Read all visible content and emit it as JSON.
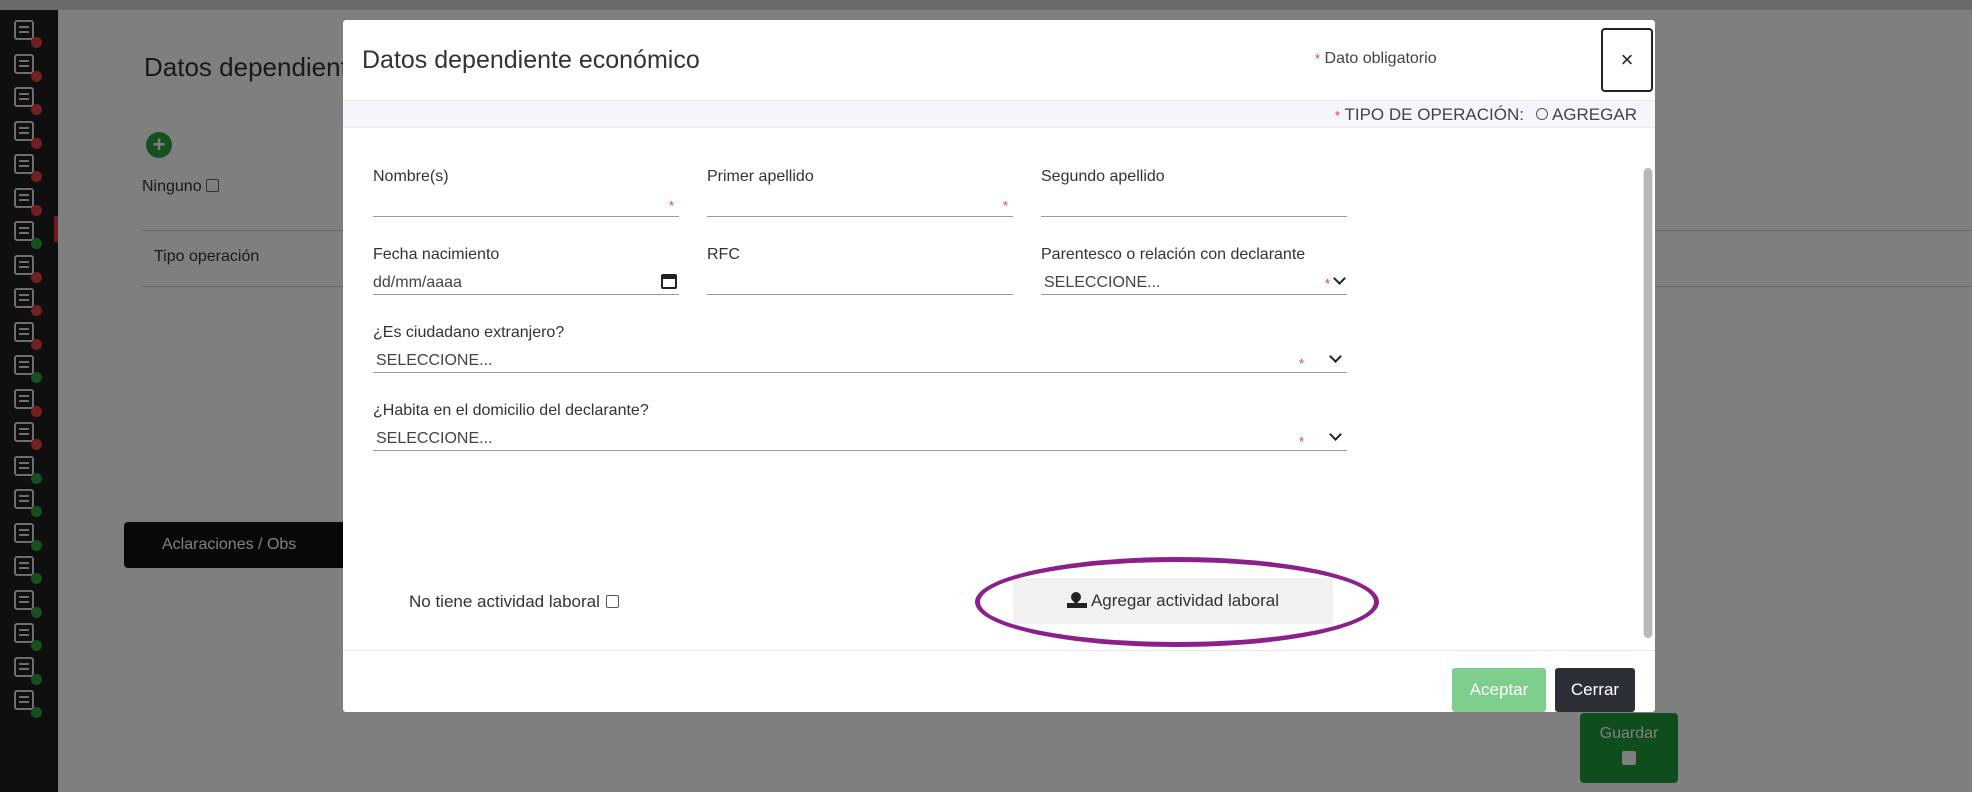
{
  "sidebar": {
    "icons": [
      {
        "name": "id-card-icon",
        "status": "red"
      },
      {
        "name": "home-arrow-icon",
        "status": "red"
      },
      {
        "name": "document-icon",
        "status": "red"
      },
      {
        "name": "building-icon",
        "status": "red"
      },
      {
        "name": "people-link-icon",
        "status": "red"
      },
      {
        "name": "family-icon",
        "status": "red"
      },
      {
        "name": "edit-form-icon",
        "status": "green"
      },
      {
        "name": "search-document-icon",
        "status": "red"
      },
      {
        "name": "house-icon",
        "status": "red"
      },
      {
        "name": "car-icon",
        "status": "red"
      },
      {
        "name": "chart-icon",
        "status": "green"
      },
      {
        "name": "handshake-icon",
        "status": "red"
      },
      {
        "name": "bus-icon",
        "status": "red"
      },
      {
        "name": "house-coin-icon",
        "status": "green"
      },
      {
        "name": "pie-chart-icon",
        "status": "green"
      },
      {
        "name": "person-network-icon",
        "status": "green"
      },
      {
        "name": "group-icon",
        "status": "green"
      },
      {
        "name": "people-row-icon",
        "status": "green"
      },
      {
        "name": "stats-board-icon",
        "status": "green"
      },
      {
        "name": "person-award-icon",
        "status": "green"
      },
      {
        "name": "checklist-icon",
        "status": "green"
      }
    ],
    "status_colors": {
      "red": "#e04040",
      "green": "#2e9e3e"
    }
  },
  "background": {
    "title": "Datos dependiente",
    "ninguno_label": "Ninguno",
    "table_header": "Tipo operación",
    "aclaraciones_label": "Aclaraciones / Obs",
    "guardar_label": "Guardar"
  },
  "modal": {
    "title": "Datos dependiente económico",
    "required_marker": "*",
    "required_note": "Dato obligatorio",
    "close_label": "×",
    "operation_label": "TIPO DE OPERACIÓN:",
    "operation_option": "AGREGAR",
    "fields": {
      "nombre": {
        "label": "Nombre(s)",
        "value": ""
      },
      "primer_apellido": {
        "label": "Primer apellido",
        "value": ""
      },
      "segundo_apellido": {
        "label": "Segundo apellido",
        "value": ""
      },
      "fecha_nacimiento": {
        "label": "Fecha nacimiento",
        "value": "dd/mm/aaaa"
      },
      "rfc": {
        "label": "RFC",
        "value": ""
      },
      "parentesco": {
        "label": "Parentesco o relación con declarante",
        "value": "SELECCIONE..."
      },
      "ciudadano_extranjero": {
        "label": "¿Es ciudadano extranjero?",
        "value": "SELECCIONE..."
      },
      "habita_domicilio": {
        "label": "¿Habita en el domicilio del declarante?",
        "value": "SELECCIONE..."
      }
    },
    "no_work_label": "No tiene actividad laboral",
    "add_work_label": "Agregar actividad laboral",
    "accept_label": "Aceptar",
    "close_button_label": "Cerrar"
  },
  "colors": {
    "accept": "#7fcf8c",
    "close_button": "#2c3036",
    "required": "#e24040",
    "highlight": "#8b1f8c"
  }
}
